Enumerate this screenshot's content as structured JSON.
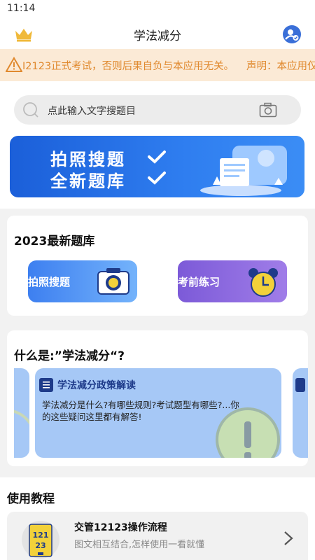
{
  "status_bar": {
    "time": "11:14"
  },
  "header": {
    "title": "学法减分"
  },
  "notice": {
    "text": "I2123正式考试，否则后果自负与本应用无关。",
    "text2": "声明：本应用仅"
  },
  "search": {
    "placeholder": "点此输入文字搜题目"
  },
  "banner": {
    "line1": "拍照搜题",
    "line2": "全新题库"
  },
  "question_bank": {
    "title": "2023最新题库",
    "tiles": [
      {
        "label": "拍照搜题"
      },
      {
        "label": "考前练习"
      }
    ]
  },
  "what_is": {
    "title": "什么是:”学法减分“?",
    "card": {
      "title": "学法减分政策解读",
      "desc": "学法减分是什么?有哪些规则?考试题型有哪些?...你的这些疑问这里都有解答!"
    }
  },
  "tutorial": {
    "title": "使用教程",
    "item": {
      "title": "交管12123操作流程",
      "subtitle": "图文相互结合,怎样使用一看就懂",
      "thumb_top": "121",
      "thumb_bottom": "23"
    }
  },
  "colors": {
    "accent_blue": "#2f7ef0",
    "notice_text": "#e0892e",
    "notice_bg": "#fbead6",
    "purple_tile": "#8b67de",
    "card_blue": "#a6c8f6"
  },
  "icons": [
    "crown-icon",
    "user-verified-icon",
    "warning-icon",
    "search-icon",
    "camera-icon",
    "checkmark-icon",
    "alarm-clock-icon",
    "document-icon",
    "exclamation-icon",
    "chevron-right-icon"
  ]
}
